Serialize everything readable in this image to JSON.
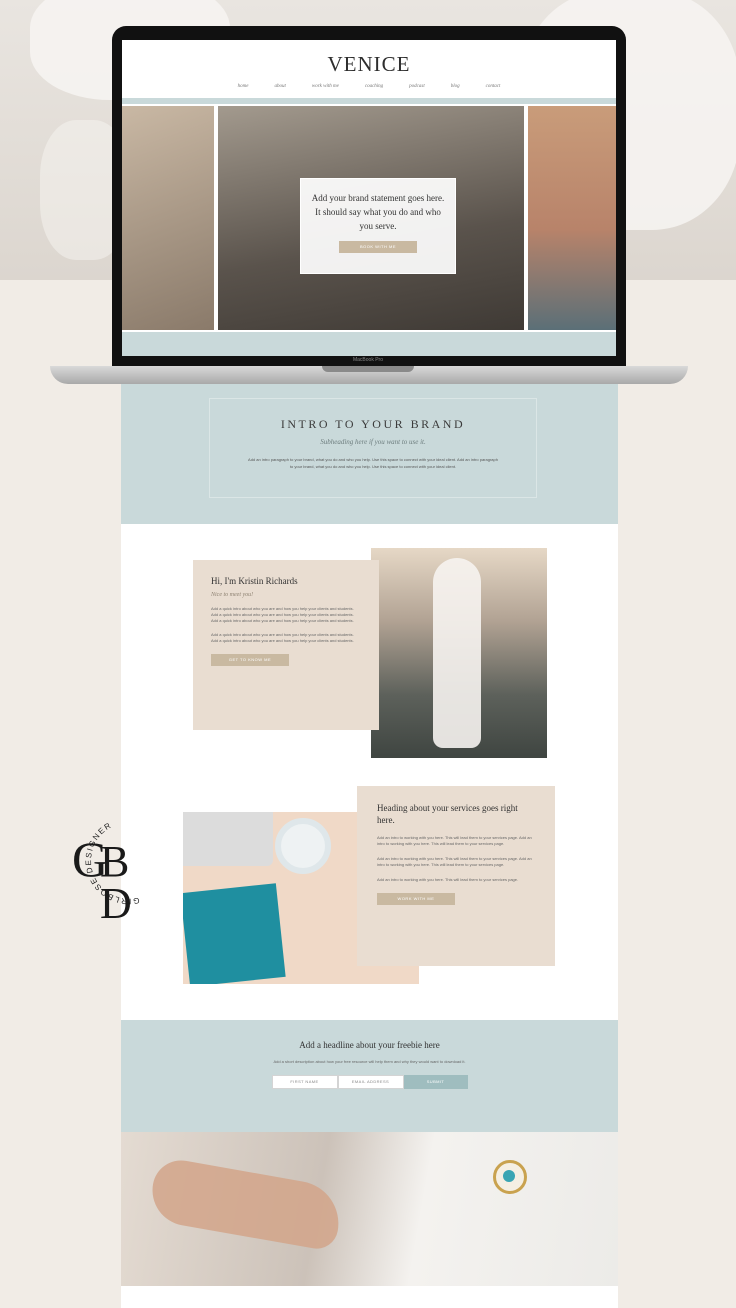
{
  "site": {
    "logo": "VENICE",
    "nav": [
      "home",
      "about",
      "work with me",
      "coaching",
      "podcast",
      "blog",
      "contact"
    ],
    "hero_statement": "Add your brand statement goes here. It should say what you do and who you serve.",
    "hero_button": "BOOK WITH ME",
    "laptop_label": "MacBook Pro"
  },
  "intro": {
    "title": "INTRO TO YOUR BRAND",
    "subtitle": "Subheading here if you want to use it.",
    "body": "Add an intro paragraph to your brand, what you do and who you help. Use this space to connect with your ideal client. Add an intro paragraph to your brand, what you do and who you help. Use this space to connect with your ideal client."
  },
  "about": {
    "title": "Hi, I'm Kristin Richards",
    "subtitle": "Nice to meet you!",
    "body1": "Add a quick intro about who you are and how you help your clients and students. Add a quick intro about who you are and how you help your clients and students. Add a quick intro about who you are and how you help your clients and students.",
    "body2": "Add a quick intro about who you are and how you help your clients and students. Add a quick intro about who you are and how you help your clients and students.",
    "button": "GET TO KNOW ME"
  },
  "services": {
    "title": "Heading about your services goes right here.",
    "p1": "Add an intro to working with you here. This will lead them to your services page. Add an intro to working with you here. This will lead them to your services page.",
    "p2": "Add an intro to working with you here. This will lead them to your services page. Add an intro to working with you here. This will lead them to your services page.",
    "p3": "Add an intro to working with you here. This will lead them to your services page.",
    "button": "WORK WITH ME"
  },
  "freebie": {
    "title": "Add a headline about your freebie here",
    "body": "Add a short description about how your free resource will help them and why they would want to download it.",
    "first_name": "FIRST NAME",
    "email": "EMAIL ADDRESS",
    "submit": "SUBMIT"
  },
  "badge": {
    "ring_text": "GIRLBOSE DESIGNER",
    "letters": "GBD"
  },
  "colors": {
    "accent_blue": "#c9d9da",
    "beige": "#e9ddd1",
    "button_tan": "#c9b9a1",
    "background": "#f1ece6"
  }
}
